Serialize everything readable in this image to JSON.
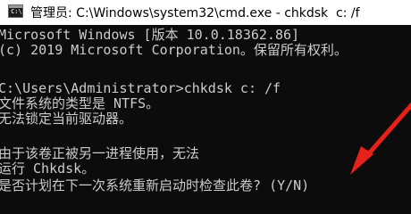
{
  "window": {
    "title": "管理员: C:\\Windows\\system32\\cmd.exe - chkdsk  c: /f",
    "icon": "cmd-console-icon",
    "icon_glyph": "C:\\"
  },
  "console": {
    "lines": [
      "Microsoft Windows [版本 10.0.18362.86]",
      "(c) 2019 Microsoft Corporation。保留所有权利。",
      "",
      "C:\\Users\\Administrator>chkdsk c: /f",
      "文件系统的类型是 NTFS。",
      "无法锁定当前驱动器。",
      "",
      "由于该卷正被另一进程使用，无法",
      "运行 Chkdsk。",
      "是否计划在下一次系统重新启动时检查此卷? (Y/N)"
    ]
  },
  "colors": {
    "console_bg": "#0c0c0c",
    "console_text": "#cccccc",
    "titlebar_bg": "#ffffff",
    "arrow": "#e8201a"
  }
}
